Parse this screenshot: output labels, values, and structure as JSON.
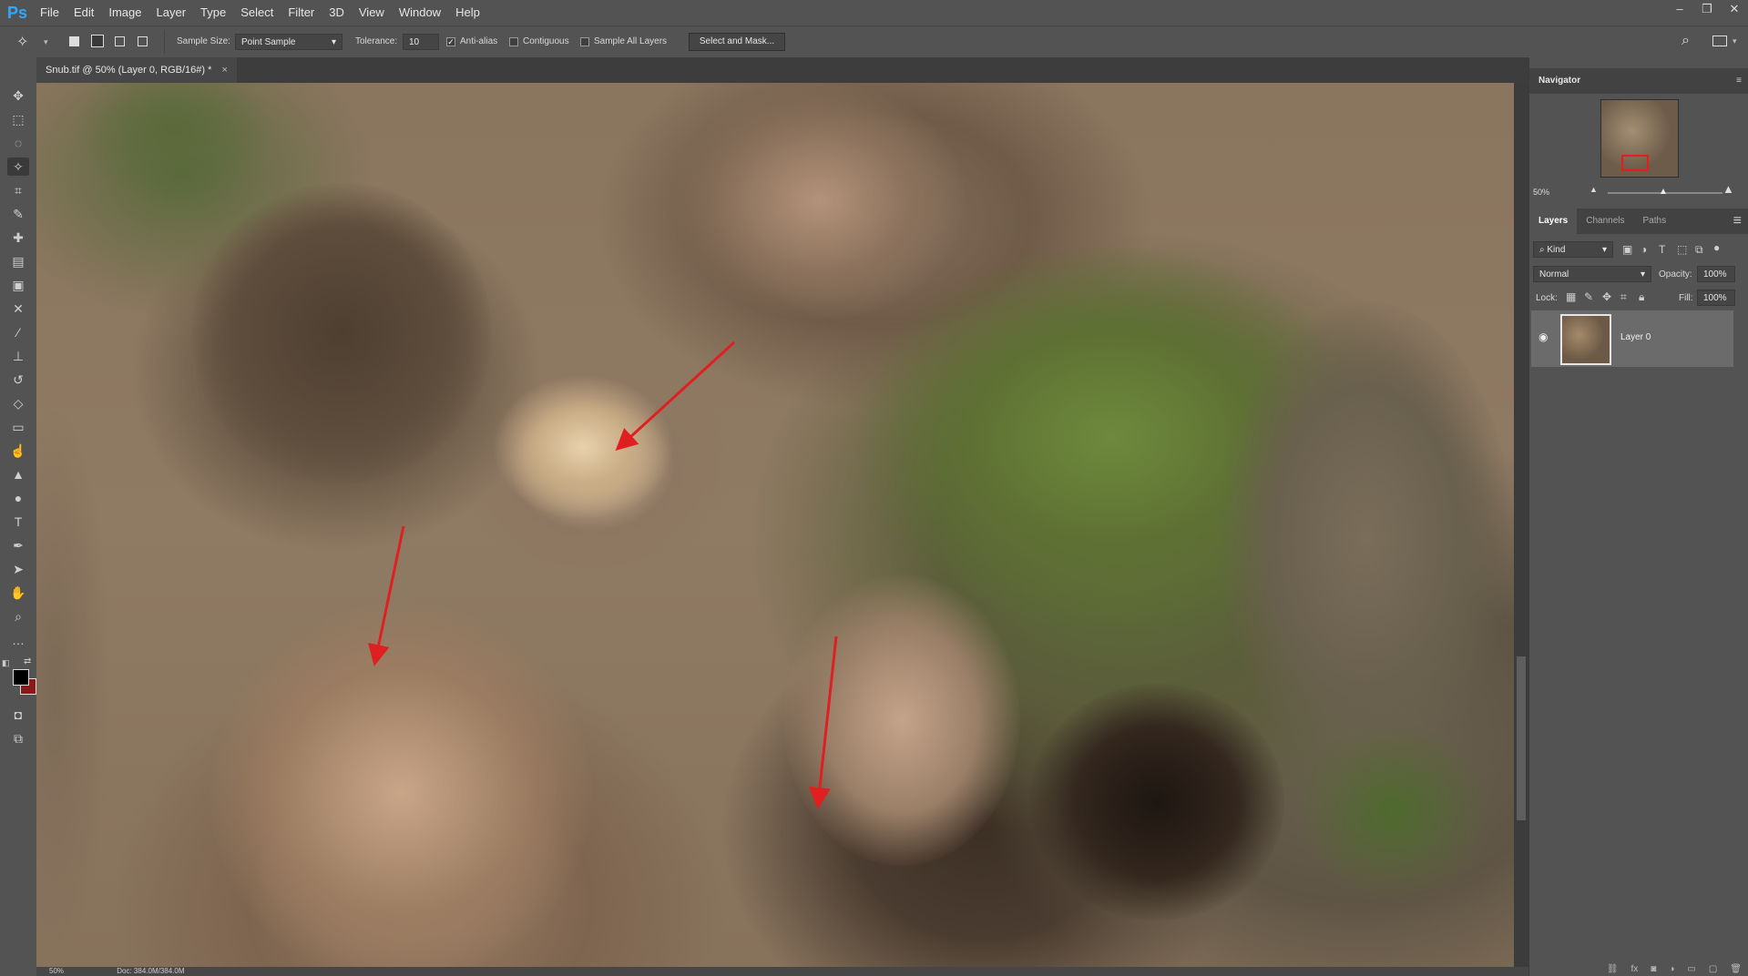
{
  "app": {
    "logo": "Ps"
  },
  "menu": [
    "File",
    "Edit",
    "Image",
    "Layer",
    "Type",
    "Select",
    "Filter",
    "3D",
    "View",
    "Window",
    "Help"
  ],
  "window_controls": {
    "minimize": "–",
    "restore": "❐",
    "close": "✕"
  },
  "options": {
    "sample_size_label": "Sample Size:",
    "sample_size_value": "Point Sample",
    "tolerance_label": "Tolerance:",
    "tolerance_value": "10",
    "anti_alias_label": "Anti-alias",
    "anti_alias_checked": true,
    "contiguous_label": "Contiguous",
    "contiguous_checked": false,
    "sample_all_layers_label": "Sample All Layers",
    "sample_all_layers_checked": false,
    "select_mask_label": "Select and Mask..."
  },
  "document": {
    "tab_title": "Snub.tif @ 50% (Layer 0, RGB/16#) *",
    "tab_close": "×"
  },
  "status": {
    "zoom": "50%",
    "doc_info": "Doc: 384.0M/384.0M"
  },
  "navigator": {
    "title": "Navigator",
    "zoom": "50%"
  },
  "layers_panel": {
    "tabs": [
      "Layers",
      "Channels",
      "Paths"
    ],
    "kind_label": "Kind",
    "blend_mode": "Normal",
    "opacity_label": "Opacity:",
    "opacity_value": "100%",
    "lock_label": "Lock:",
    "fill_label": "Fill:",
    "fill_value": "100%",
    "layers": [
      {
        "name": "Layer 0",
        "visible": true
      }
    ]
  },
  "colors": {
    "accent_red": "#e02020",
    "ps_blue": "#31a8ff"
  }
}
